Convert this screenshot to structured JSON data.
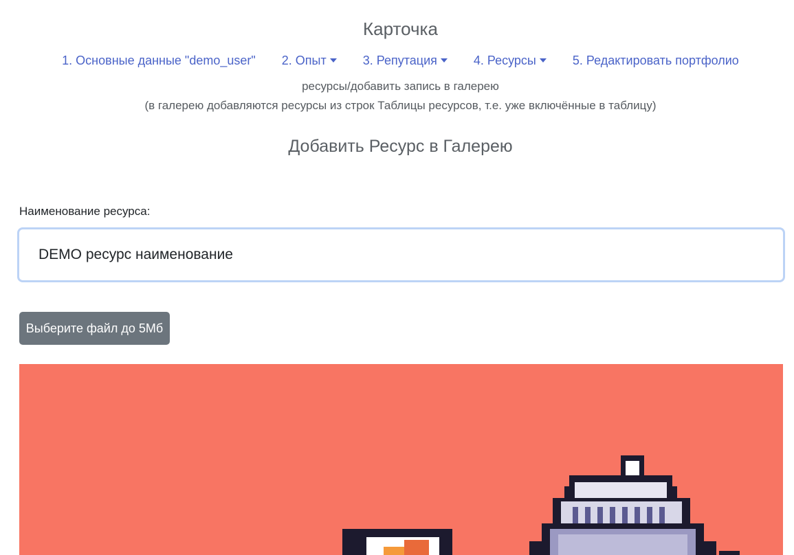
{
  "header": {
    "title": "Карточка"
  },
  "nav": {
    "items": [
      {
        "label": "1. Основные данные \"demo_user\"",
        "dropdown": false
      },
      {
        "label": "2. Опыт",
        "dropdown": true
      },
      {
        "label": "3. Репутация",
        "dropdown": true
      },
      {
        "label": "4. Ресурсы",
        "dropdown": true
      },
      {
        "label": "5. Редактировать портфолио",
        "dropdown": false
      }
    ]
  },
  "breadcrumb": {
    "path": "ресурсы/добавить запись в галерею",
    "hint": "(в галерею добавляются ресурсы из строк Таблицы ресурсов, т.е. уже включённые в таблицу)"
  },
  "form": {
    "heading": "Добавить Ресурс в Галерею",
    "name_label": "Наименование ресурса:",
    "name_value": "DEMO ресурс наименование",
    "file_button_label": "Выберите файл до 5Мб"
  },
  "preview": {
    "background": "#f87563",
    "illustration": "pixel-art-cake-and-coffee"
  },
  "colors": {
    "link": "#4a63c8",
    "button": "#6c757d",
    "input_focus_border": "#bcd3f6"
  }
}
